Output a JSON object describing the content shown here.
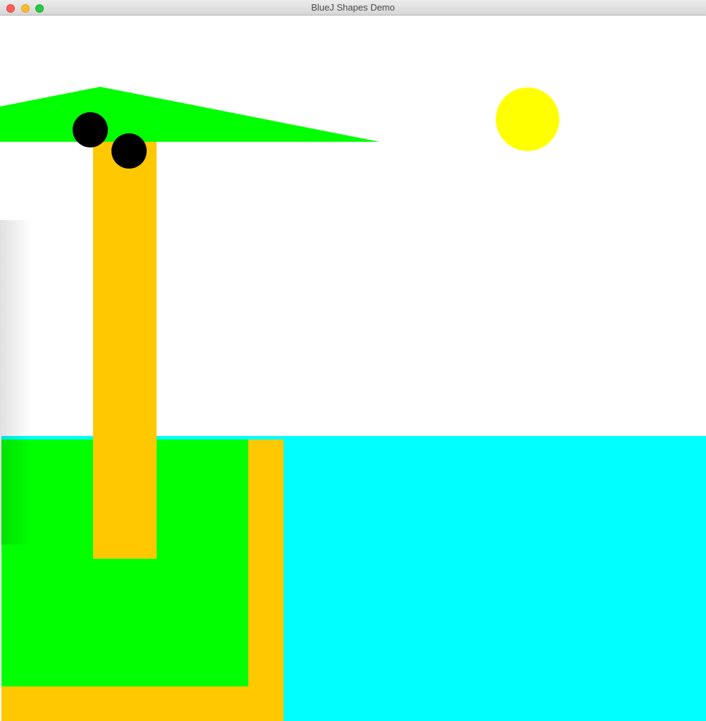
{
  "window": {
    "title": "BlueJ Shapes Demo",
    "controls": {
      "close": "close-button",
      "minimize": "minimize-button",
      "zoom": "zoom-button"
    }
  },
  "colors": {
    "sky": "#ffffff",
    "sea": "#00ffff",
    "sand": "#ffc800",
    "grass": "#00ff00",
    "sun": "#ffff00",
    "coconut": "#000000"
  },
  "icons": [
    "close-icon",
    "minimize-icon",
    "zoom-icon"
  ]
}
